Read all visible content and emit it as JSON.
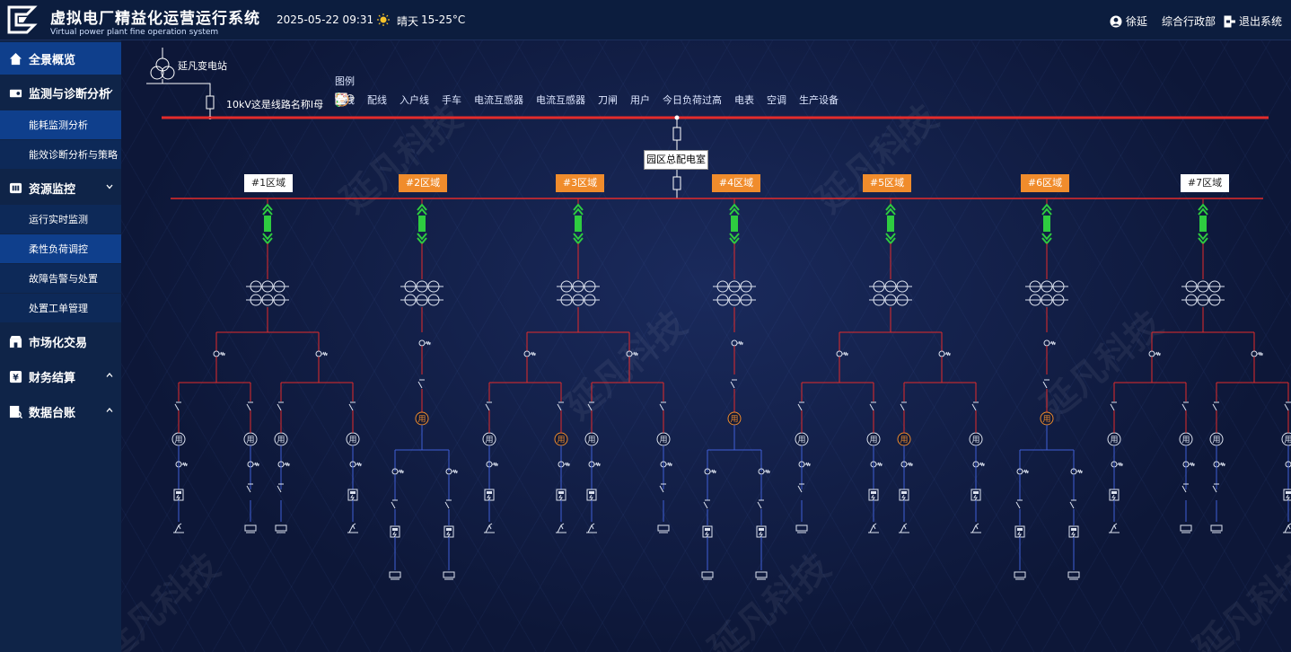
{
  "app": {
    "title": "虚拟电厂精益化运营运行系统",
    "subtitle": "Virtual power plant fine operation system",
    "datetime": "2025-05-22 09:31",
    "weather": {
      "icon": "sun-icon",
      "text": "晴天",
      "temp": "15-25°C"
    },
    "user": {
      "icon": "user-icon",
      "name": "徐延"
    },
    "department": "综合行政部",
    "logout": {
      "icon": "logout-icon",
      "label": "退出系统"
    }
  },
  "colors": {
    "accent": "#0f3f8c",
    "orange": "#f08c2c",
    "busbar": "#e32b2b",
    "green": "#2ecc40",
    "incoming": "#3f5fd6"
  },
  "sidebar": {
    "items": [
      {
        "label": "全景概览",
        "icon": "home-icon",
        "level": 1,
        "active": true
      },
      {
        "label": "监测与诊断分析",
        "icon": "monitor-icon",
        "level": 1,
        "chevron": "down"
      },
      {
        "label": "能耗监测分析",
        "level": 2
      },
      {
        "label": "能效诊断分析与策略",
        "level": 2
      },
      {
        "label": "资源监控",
        "icon": "resource-icon",
        "level": 1,
        "chevron": "down"
      },
      {
        "label": "运行实时监测",
        "level": 2
      },
      {
        "label": "柔性负荷调控",
        "level": 2
      },
      {
        "label": "故障告警与处置",
        "level": 2
      },
      {
        "label": "处置工单管理",
        "level": 2
      },
      {
        "label": "市场化交易",
        "icon": "market-icon",
        "level": 1
      },
      {
        "label": "财务结算",
        "icon": "finance-icon",
        "level": 1,
        "chevron": "up"
      },
      {
        "label": "数据台账",
        "icon": "ledger-icon",
        "level": 1,
        "chevron": "up"
      }
    ]
  },
  "diagram": {
    "station": "延凡变电站",
    "line_name": "10kV这是线路名称I母",
    "hub": "园区总配电室",
    "legend_title": "图例",
    "legend": [
      {
        "label": "母线",
        "icon": "busbar-line-icon"
      },
      {
        "label": "配线",
        "icon": "distribution-line-icon"
      },
      {
        "label": "入户线",
        "icon": "incoming-line-icon"
      },
      {
        "label": "手车",
        "icon": "handcart-icon"
      },
      {
        "label": "电流互感器",
        "icon": "current-transformer-icon"
      },
      {
        "label": "电流互感器",
        "icon": "current-transformer-small-icon"
      },
      {
        "label": "刀闸",
        "icon": "knife-switch-icon"
      },
      {
        "label": "用户",
        "icon": "user-node-icon"
      },
      {
        "label": "今日负荷过高",
        "icon": "overload-user-icon"
      },
      {
        "label": "电表",
        "icon": "meter-icon"
      },
      {
        "label": "空调",
        "icon": "aircon-icon"
      },
      {
        "label": "生产设备",
        "icon": "production-equipment-icon"
      }
    ],
    "zones": [
      {
        "label": "#1区域",
        "alert": false
      },
      {
        "label": "#2区域",
        "alert": true
      },
      {
        "label": "#3区域",
        "alert": true
      },
      {
        "label": "#4区域",
        "alert": true
      },
      {
        "label": "#5区域",
        "alert": true
      },
      {
        "label": "#6区域",
        "alert": true
      },
      {
        "label": "#7区域",
        "alert": false
      }
    ],
    "user_label": "用",
    "aircon_label": "空调",
    "watermark": "延凡科技"
  }
}
